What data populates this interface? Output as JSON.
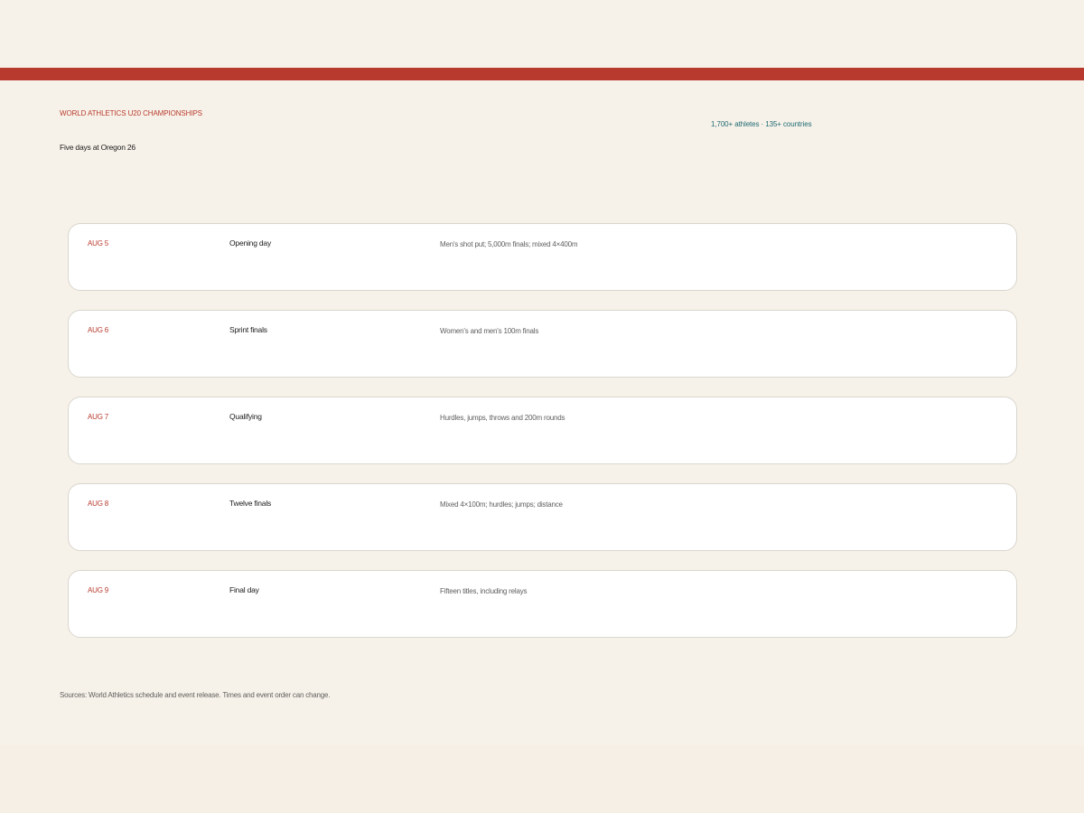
{
  "colors": {
    "accent": "#b83a2e",
    "teal": "#1f6b73",
    "page_bg": "#f7f2e9",
    "card_bg": "#ffffff",
    "card_border": "#d9d6ce"
  },
  "header": {
    "eyebrow": "WORLD ATHLETICS U20 CHAMPIONSHIPS",
    "headline": "Five days at Oregon 26",
    "stats": "1,700+ athletes · 135+ countries"
  },
  "days": [
    {
      "date": "AUG 5",
      "title": "Opening day",
      "desc": "Men's shot put; 5,000m finals; mixed 4×400m"
    },
    {
      "date": "AUG 6",
      "title": "Sprint finals",
      "desc": "Women's and men's 100m finals"
    },
    {
      "date": "AUG 7",
      "title": "Qualifying",
      "desc": "Hurdles, jumps, throws and 200m rounds"
    },
    {
      "date": "AUG 8",
      "title": "Twelve finals",
      "desc": "Mixed 4×100m; hurdles; jumps; distance"
    },
    {
      "date": "AUG 9",
      "title": "Final day",
      "desc": "Fifteen titles, including relays"
    }
  ],
  "footer": {
    "sources": "Sources: World Athletics schedule and event release. Times and event order can change."
  }
}
